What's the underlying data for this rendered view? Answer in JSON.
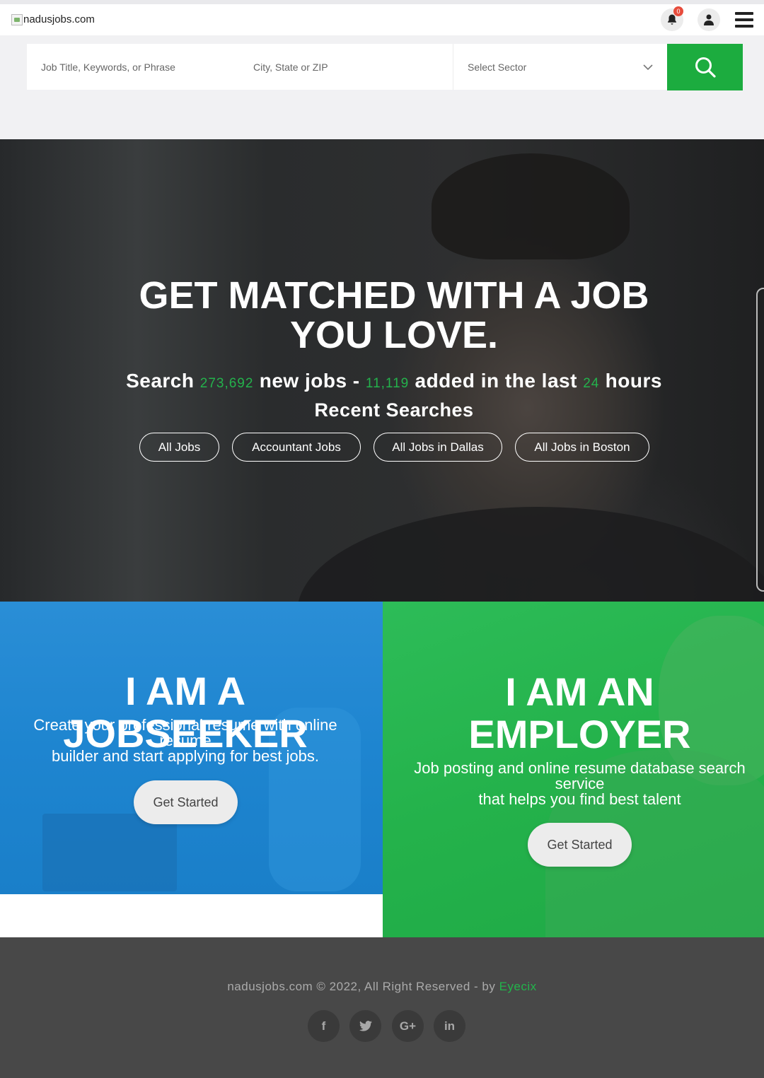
{
  "header": {
    "logo_alt": "nadusjobs.com",
    "notification_count": "0",
    "icons": [
      "bell-icon",
      "user-icon",
      "hamburger-menu-icon"
    ]
  },
  "search": {
    "keyword_placeholder": "Job Title, Keywords, or Phrase",
    "location_placeholder": "City, State or ZIP",
    "sector_selected": "Select Sector",
    "button_icon": "search-icon"
  },
  "hero": {
    "title_line1": "GET MATCHED WITH A JOB",
    "title_line2": "YOU LOVE.",
    "sub": {
      "w1": "Search",
      "n1": "273,692",
      "w2": "new jobs -",
      "n2": "11,119",
      "w3": "added in the last",
      "n3": "24",
      "w4": "hours"
    },
    "recent_title": "Recent Searches",
    "recent": [
      "All Jobs",
      "Accountant Jobs",
      "All Jobs in Dallas",
      "All Jobs in Boston"
    ]
  },
  "jobseeker": {
    "title": "I AM A JOBSEEKER",
    "line1": "Create your professional resume with online",
    "line2": "resume",
    "line3": "builder and start applying for best jobs.",
    "button": "Get Started"
  },
  "employer": {
    "title_line1": "I AM AN",
    "title_line2": "EMPLOYER",
    "line1": "Job posting and online resume database search",
    "line2": "service",
    "line3": "that helps you find best talent",
    "button": "Get Started"
  },
  "footer": {
    "copyright": "nadusjobs.com © 2022, All Right Reserved - by",
    "brand": "Eyecix",
    "social": [
      {
        "icon": "facebook-icon",
        "glyph": "f"
      },
      {
        "icon": "twitter-icon",
        "glyph": "🐦"
      },
      {
        "icon": "google-plus-icon",
        "glyph": "G+"
      },
      {
        "icon": "linkedin-icon",
        "glyph": "in"
      }
    ]
  },
  "colors": {
    "accent_green": "#1cac3f",
    "blue_panel": "#1e85d0",
    "footer_bg": "#484848"
  }
}
